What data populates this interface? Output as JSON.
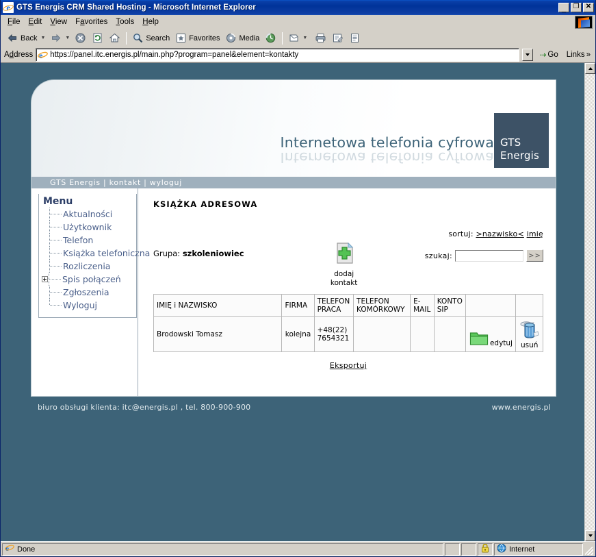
{
  "window": {
    "title": "GTS Energis CRM Shared Hosting - Microsoft Internet Explorer",
    "minimize_label": "_",
    "maximize_label": "❐",
    "close_label": "✕"
  },
  "menubar": {
    "items": [
      {
        "label": "File",
        "accel": "F"
      },
      {
        "label": "Edit",
        "accel": "E"
      },
      {
        "label": "View",
        "accel": "V"
      },
      {
        "label": "Favorites",
        "accel": "a"
      },
      {
        "label": "Tools",
        "accel": "T"
      },
      {
        "label": "Help",
        "accel": "H"
      }
    ]
  },
  "toolbar": {
    "back_label": "Back",
    "forward_label": "",
    "stop_label": "",
    "refresh_label": "",
    "home_label": "",
    "search_label": "Search",
    "favorites_label": "Favorites",
    "media_label": "Media",
    "history_label": "",
    "mail_label": "",
    "print_label": "",
    "edit_label": "",
    "discuss_label": ""
  },
  "address": {
    "label": "Address",
    "url": "https://panel.itc.energis.pl/main.php?program=panel&element=kontakty",
    "go_label": "Go",
    "links_label": "Links",
    "links_chevron": "»"
  },
  "status": {
    "text": "Done",
    "zone": "Internet",
    "lock_icon": "lock-icon"
  },
  "site": {
    "tagline": "Internetowa telefonia cyfrowa",
    "logo": {
      "line1": "GTS",
      "line2": "Energis"
    },
    "nav": {
      "brand": "GTS Energis",
      "sep1": "|",
      "kontakt": "kontakt",
      "sep2": "|",
      "wyloguj": "wyloguj",
      "full": "GTS Energis | kontakt | wyloguj"
    },
    "menu": {
      "title": "Menu",
      "items": [
        {
          "label": "Aktualności",
          "expandable": false
        },
        {
          "label": "Użytkownik",
          "expandable": false
        },
        {
          "label": "Telefon",
          "expandable": false
        },
        {
          "label": "Książka telefoniczna",
          "expandable": false
        },
        {
          "label": "Rozliczenia",
          "expandable": false
        },
        {
          "label": "Spis połączeń",
          "expandable": true
        },
        {
          "label": "Zgłoszenia",
          "expandable": false
        },
        {
          "label": "Wyloguj",
          "expandable": false
        }
      ]
    },
    "content": {
      "page_title": "KSIĄŻKA ADRESOWA",
      "sort_label": "sortuj:",
      "sort_active": ">nazwisko<",
      "sort_other": "imię",
      "group_prefix": "Grupa:",
      "group_value": "szkoleniowiec",
      "add_contact": {
        "line1": "dodaj",
        "line2": "kontakt",
        "icon": "document-plus-icon"
      },
      "search_label": "szukaj:",
      "search_value": "",
      "search_placeholder": "",
      "search_submit": ">>",
      "table": {
        "headers": [
          "IMIĘ i NAZWISKO",
          "FIRMA",
          "TELEFON PRACA",
          "TELEFON KOMÓRKOWY",
          "E-MAIL",
          "KONTO SIP",
          "",
          ""
        ],
        "rows": [
          {
            "name": "Brodowski Tomasz",
            "firma": "kolejna",
            "telefon_praca": "+48(22) 7654321",
            "telefon_komorkowy": "",
            "email": "",
            "konto_sip": "",
            "edit_label": "edytuj",
            "delete_label": "usuń"
          }
        ]
      },
      "export_label": "Eksportuj"
    },
    "footer": {
      "left": "biuro obsługi klienta: itc@energis.pl , tel. 800-900-900",
      "right": "www.energis.pl"
    }
  },
  "colors": {
    "page_bg": "#3d6378",
    "accent_orange": "#f26a1b",
    "logo_slate": "#3d5266",
    "nav_bar": "#9fb0bd",
    "titlebar_blue": "#003399"
  }
}
